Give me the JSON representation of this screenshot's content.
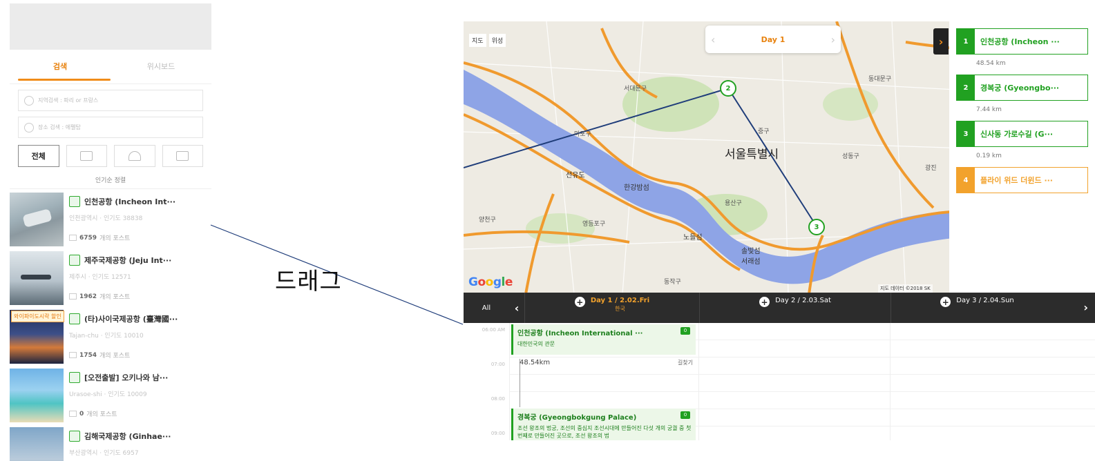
{
  "left": {
    "tabs": [
      {
        "label": "검색"
      },
      {
        "label": "위시보드"
      }
    ],
    "search_region_placeholder": "지역검색 : 파리 or 프랑스",
    "search_place_placeholder": "장소 검색 : 에펠탑",
    "filter_all_label": "전체",
    "sort_label": "인기순 정렬",
    "places": [
      {
        "title": "인천공항 (Incheon Int···",
        "sub": "인천광역시 · 인기도 38838",
        "posts": "6759",
        "posts_suffix": "개의 포스트"
      },
      {
        "title": "제주국제공항 (Jeju Int···",
        "sub": "제주시 · 인기도 12571",
        "posts": "1962",
        "posts_suffix": "개의 포스트"
      },
      {
        "title": "(타)사이국제공항 (臺灣國···",
        "sub": "Tajan-chu · 인기도 10010",
        "posts": "1754",
        "posts_suffix": "개의 포스트",
        "badge": "와이파이도시락 할인"
      },
      {
        "title": "[오전출발] 오키나와 남···",
        "sub": "Urasoe-shi · 인기도 10009",
        "posts": "0",
        "posts_suffix": "개의 포스트"
      },
      {
        "title": "김해국제공항 (Ginhae···",
        "sub": "부산광역시 · 인기도 6957",
        "posts": "",
        "posts_suffix": ""
      }
    ]
  },
  "drag_label": "드래그",
  "map": {
    "type_buttons": [
      "지도",
      "위성"
    ],
    "day_nav_label": "Day 1",
    "expand_icon": "›",
    "copyright": "지도 데이터 ©2018 SK",
    "google_letters": [
      "G",
      "o",
      "o",
      "g",
      "l",
      "e"
    ],
    "labels": {
      "city": "서울특별시",
      "seodaemun": "서대문구",
      "mapo": "마포구",
      "seonyudo": "선유도",
      "hangang": "한강밤섬",
      "yangcheon": "양천구",
      "yeongdeungpo": "영등포구",
      "yongsan": "용산구",
      "nodeul": "노들섬",
      "dongjak": "동작구",
      "seorae": "솔빛섬\n서래섬",
      "junggu": "중구",
      "dongdaemun": "동대문구",
      "seongdong": "성동구",
      "gwangjin": "광진"
    },
    "markers": [
      "2",
      "3"
    ],
    "route_items": [
      {
        "num": "1",
        "name": "인천공항 (Incheon ···",
        "dist": "48.54 km",
        "color": "green"
      },
      {
        "num": "2",
        "name": "경복궁 (Gyeongbo···",
        "dist": "7.44 km",
        "color": "green"
      },
      {
        "num": "3",
        "name": "신사동 가로수길 (G···",
        "dist": "0.19 km",
        "color": "green"
      },
      {
        "num": "4",
        "name": "플라이 위드 더윈드 ···",
        "dist": "",
        "color": "orange"
      }
    ]
  },
  "schedule": {
    "all_label": "All",
    "prev_icon": "‹",
    "next_icon": "›",
    "days": [
      {
        "label": "Day 1",
        "date": "2.02.Fri",
        "sub": "한국",
        "active": true
      },
      {
        "label": "Day 2",
        "date": "2.03.Sat",
        "sub": "",
        "active": false
      },
      {
        "label": "Day 3",
        "date": "2.04.Sun",
        "sub": "",
        "active": false
      }
    ],
    "times": [
      "06:00 AM",
      "07:00",
      "08:00",
      "09:00"
    ],
    "events": [
      {
        "title": "인천공항 (Incheon International ···",
        "desc": "대한민국의 관문",
        "flag": "0"
      },
      {
        "title": "경복궁 (Gyeongbokgung Palace)",
        "desc": "조선 왕조의 법궁, 조선의 중심지 조선시대에 만들어진 다섯 개의 궁궐 중 첫 번째로 만들어진 곳으로, 조선 왕조의 법",
        "flag": "0"
      }
    ],
    "travel_distance": "48.54km",
    "find_route_label": "길찾기"
  }
}
